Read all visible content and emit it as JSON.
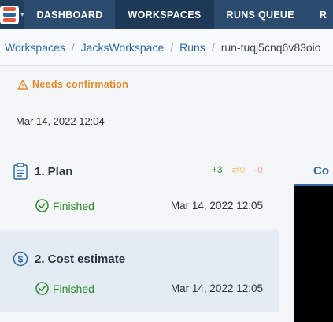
{
  "nav": {
    "items": [
      {
        "label": "DASHBOARD",
        "active": false
      },
      {
        "label": "WORKSPACES",
        "active": true
      },
      {
        "label": "RUNS QUEUE",
        "active": false
      },
      {
        "label": "R",
        "active": false
      }
    ]
  },
  "breadcrumb": {
    "items": [
      "Workspaces",
      "JacksWorkspace",
      "Runs"
    ],
    "current": "run-tuqj5cnq6v83oio"
  },
  "run": {
    "status_label": "Needs confirmation",
    "started_at": "Mar 14, 2022 12:04"
  },
  "steps": [
    {
      "title": "1. Plan",
      "status": "Finished",
      "time": "Mar 14, 2022 12:05",
      "counts": {
        "add": "+3",
        "change": "⇄0",
        "destroy": "-0"
      }
    },
    {
      "title": "2. Cost estimate",
      "status": "Finished",
      "time": "Mar 14, 2022 12:05"
    }
  ],
  "right_panel": {
    "tab_label": "Co"
  },
  "colors": {
    "nav_bg": "#2b4c6f",
    "nav_active": "#1e3957",
    "link": "#2e6aa6",
    "warning": "#e08a2c",
    "success": "#2e8b2e"
  }
}
